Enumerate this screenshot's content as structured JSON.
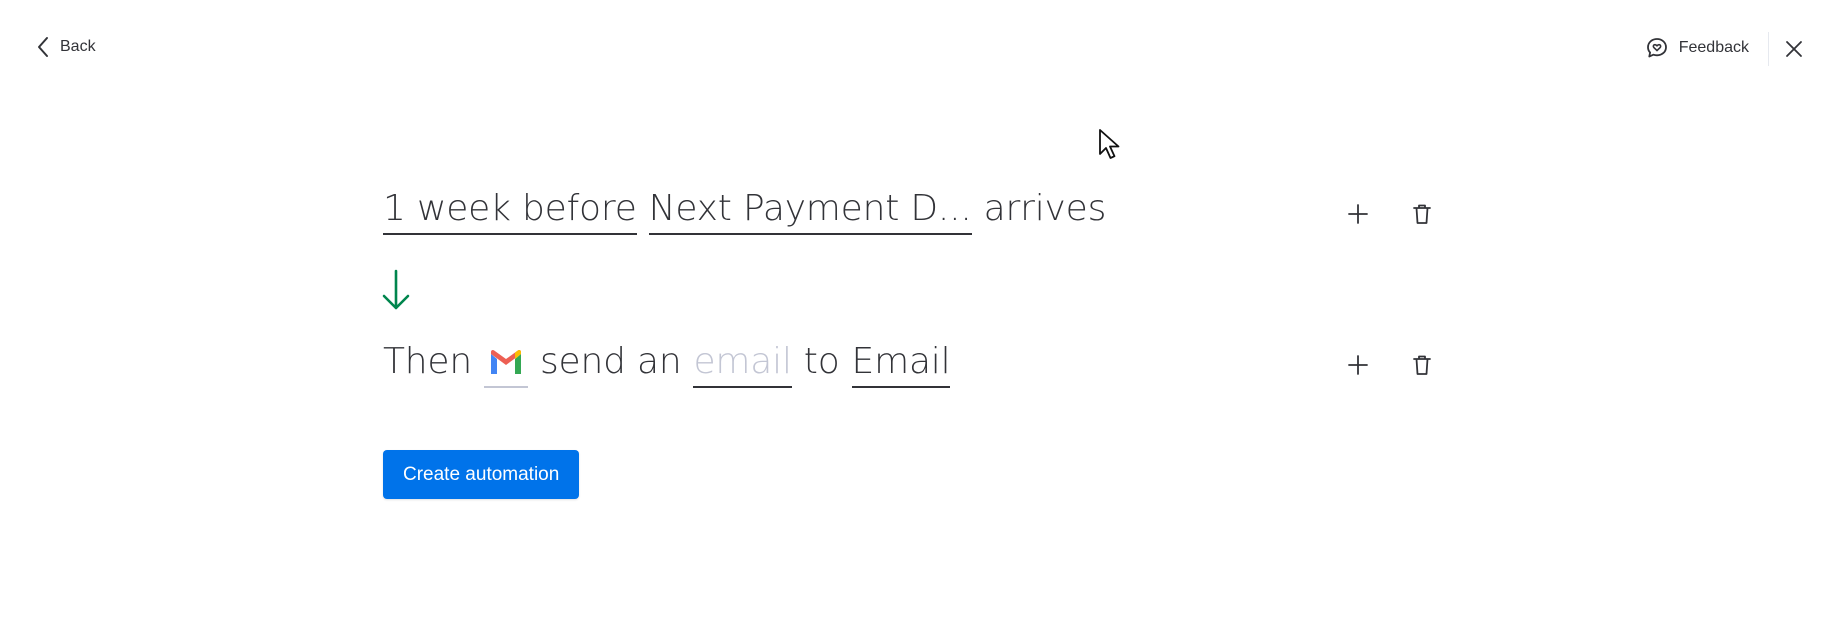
{
  "header": {
    "back_label": "Back",
    "feedback_label": "Feedback"
  },
  "trigger": {
    "timing_value": "1 week before",
    "column_value": "Next Payment D...",
    "suffix": "arrives"
  },
  "action": {
    "prefix": "Then",
    "integration_icon": "gmail-icon",
    "verb": "send an",
    "object_placeholder": "email",
    "connector": "to",
    "recipient_value": "Email"
  },
  "primary_button": {
    "label": "Create automation"
  },
  "colors": {
    "accent": "#0073ea",
    "arrow": "#00854d",
    "text": "#323338",
    "placeholder": "#c3c6d4"
  }
}
